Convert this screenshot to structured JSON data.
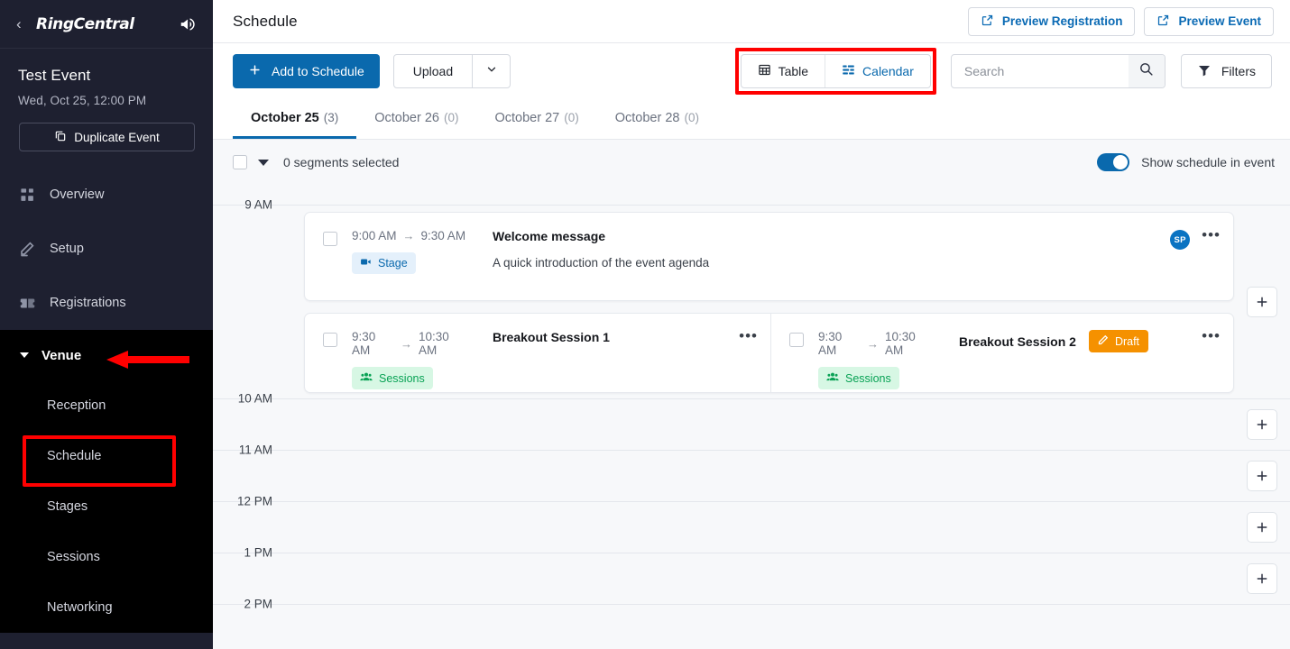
{
  "sidebar": {
    "brand": "RingCentral",
    "back_icon": "chevron-left-icon",
    "megaphone_icon": "megaphone-icon",
    "event_name": "Test Event",
    "event_date": "Wed, Oct 25, 12:00 PM",
    "duplicate_label": "Duplicate Event",
    "nav": [
      {
        "label": "Overview",
        "icon": "grid-icon"
      },
      {
        "label": "Setup",
        "icon": "pencil-icon"
      },
      {
        "label": "Registrations",
        "icon": "ticket-icon"
      }
    ],
    "group": {
      "label": "Venue",
      "expanded": true,
      "items": [
        {
          "label": "Reception",
          "active": false
        },
        {
          "label": "Schedule",
          "active": true
        },
        {
          "label": "Stages",
          "active": false
        },
        {
          "label": "Sessions",
          "active": false
        },
        {
          "label": "Networking",
          "active": false
        }
      ]
    }
  },
  "topbar": {
    "title": "Schedule",
    "preview_registration": "Preview Registration",
    "preview_event": "Preview Event",
    "external_link_icon": "external-link-icon"
  },
  "toolbar": {
    "add_label": "Add to Schedule",
    "plus_icon": "plus-icon",
    "upload_label": "Upload",
    "chevron_icon": "chevron-down-icon",
    "view_table": "Table",
    "view_calendar": "Calendar",
    "table_icon": "table-icon",
    "calendar_icon": "calendar-view-icon",
    "search_placeholder": "Search",
    "search_value": "",
    "search_icon": "search-icon",
    "filters_label": "Filters",
    "filter_icon": "funnel-icon"
  },
  "tabs": [
    {
      "label": "October 25",
      "count": "(3)",
      "active": true
    },
    {
      "label": "October 26",
      "count": "(0)",
      "active": false
    },
    {
      "label": "October 27",
      "count": "(0)",
      "active": false
    },
    {
      "label": "October 28",
      "count": "(0)",
      "active": false
    }
  ],
  "selection_bar": {
    "text": "0 segments selected",
    "checkbox_checked": false,
    "caret_icon": "caret-down-icon",
    "toggle_label": "Show schedule in event",
    "toggle_on": true
  },
  "calendar": {
    "time_labels": [
      "9 AM",
      "10 AM",
      "11 AM",
      "12 PM",
      "1 PM",
      "2 PM"
    ],
    "add_icon": "plus-icon",
    "events": [
      {
        "start": "9:00 AM",
        "end": "9:30 AM",
        "arrow": "→",
        "title": "Welcome message",
        "description": "A quick introduction of the event agenda",
        "badge": "Stage",
        "badge_type": "stage",
        "badge_icon": "video-camera-icon",
        "avatar": "SP",
        "menu_icon": "more-horizontal-icon"
      },
      {
        "start": "9:30 AM",
        "end": "10:30 AM",
        "arrow": "→",
        "title": "Breakout Session 1",
        "description": "",
        "badge": "Sessions",
        "badge_type": "sessions",
        "badge_icon": "people-icon",
        "menu_icon": "more-horizontal-icon"
      },
      {
        "start": "9:30 AM",
        "end": "10:30 AM",
        "arrow": "→",
        "title": "Breakout Session 2",
        "description": "",
        "badge": "Sessions",
        "badge_type": "sessions",
        "badge_icon": "people-icon",
        "status": "Draft",
        "status_icon": "pencil-icon",
        "menu_icon": "more-horizontal-icon"
      }
    ]
  },
  "colors": {
    "brand_blue": "#0a69ad",
    "sidebar_bg": "#1e2030",
    "group_bg": "#000000",
    "annotation_red": "#ff0000",
    "draft_orange": "#f59100",
    "sessions_green": "#09a255"
  }
}
